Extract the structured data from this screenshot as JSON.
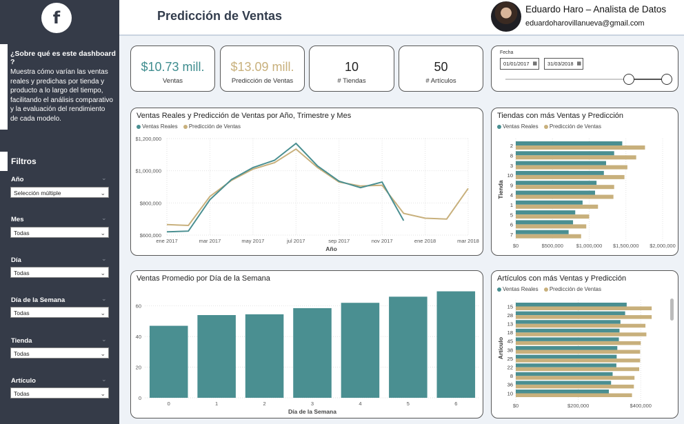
{
  "sidebar": {
    "logo": "f",
    "about_title": "¿Sobre qué es este  dashboard ?",
    "about_text": "Muestra cómo varían las ventas reales y predichas por tienda y producto a lo largo del tiempo, facilitando el análisis comparativo y la evaluación del rendimiento de cada modelo.",
    "filters_title": "Filtros",
    "filters": [
      {
        "label": "Año",
        "value": "Selección múltiple"
      },
      {
        "label": "Mes",
        "value": "Todas"
      },
      {
        "label": "Día",
        "value": "Todas"
      },
      {
        "label": "Día de la Semana",
        "value": "Todas"
      },
      {
        "label": "Tienda",
        "value": "Todas"
      },
      {
        "label": "Artículo",
        "value": "Todas"
      }
    ]
  },
  "header": {
    "title": "Predicción de Ventas",
    "author_name": "Eduardo Haro – Analista de Datos",
    "author_email": "eduardoharovillanueva@gmail.com"
  },
  "kpis": [
    {
      "value": "$10.73 mill.",
      "label": "Ventas",
      "color": "#3f8d8f"
    },
    {
      "value": "$13.09 mill.",
      "label": "Predicción de Ventas",
      "color": "#c8b07c"
    },
    {
      "value": "10",
      "label": "# Tiendas",
      "color": "#222222"
    },
    {
      "value": "50",
      "label": "# Artículos",
      "color": "#222222"
    }
  ],
  "date_filter": {
    "label": "Fecha",
    "start": "01/01/2017",
    "end": "31/03/2018"
  },
  "colors": {
    "real": "#4a8f91",
    "pred": "#c8b07c"
  },
  "chart_data": [
    {
      "type": "line",
      "title": "Ventas Reales y Predicción de Ventas por Año, Trimestre y Mes",
      "xlabel": "Año",
      "ylabel": "",
      "x": [
        "ene 2017",
        "feb 2017",
        "mar 2017",
        "abr 2017",
        "may 2017",
        "jun 2017",
        "jul 2017",
        "ago 2017",
        "sep 2017",
        "oct 2017",
        "nov 2017",
        "dic 2017",
        "ene 2018",
        "feb 2018",
        "mar 2018"
      ],
      "x_ticks": [
        "ene 2017",
        "mar 2017",
        "may 2017",
        "jul 2017",
        "sep 2017",
        "nov 2017",
        "ene 2018",
        "mar 2018"
      ],
      "y_ticks": [
        "$600,000",
        "$800,000",
        "$1,000,000",
        "$1,200,000"
      ],
      "ylim": [
        600000,
        1200000
      ],
      "series": [
        {
          "name": "Ventas Reales",
          "values": [
            620000,
            625000,
            820000,
            945000,
            1020000,
            1065000,
            1170000,
            1030000,
            935000,
            895000,
            930000,
            690000,
            null,
            null,
            null
          ]
        },
        {
          "name": "Predicción de Ventas",
          "values": [
            665000,
            660000,
            840000,
            940000,
            1010000,
            1050000,
            1135000,
            1020000,
            930000,
            905000,
            910000,
            735000,
            705000,
            700000,
            890000
          ]
        }
      ],
      "grid": true,
      "legend": "top-left"
    },
    {
      "type": "bar",
      "orientation": "horizontal",
      "title": "Tiendas con más Ventas y Predicción",
      "ylabel": "Tienda",
      "xlabel": "",
      "categories": [
        "2",
        "8",
        "3",
        "10",
        "9",
        "4",
        "1",
        "5",
        "6",
        "7"
      ],
      "x_ticks": [
        "$0",
        "$500,000",
        "$1,000,000",
        "$1,500,000",
        "$2,000,000"
      ],
      "xlim": [
        0,
        2000000
      ],
      "series": [
        {
          "name": "Ventas Reales",
          "values": [
            1450000,
            1340000,
            1230000,
            1200000,
            1100000,
            1080000,
            910000,
            810000,
            780000,
            720000
          ]
        },
        {
          "name": "Predicción de Ventas",
          "values": [
            1760000,
            1640000,
            1520000,
            1480000,
            1340000,
            1330000,
            1120000,
            1000000,
            960000,
            890000
          ]
        }
      ],
      "grid": true,
      "legend": "top-left"
    },
    {
      "type": "bar",
      "title": "Ventas Promedio por Día de la Semana",
      "xlabel": "Día de la Semana",
      "ylabel": "",
      "categories": [
        "0",
        "1",
        "2",
        "3",
        "4",
        "5",
        "6"
      ],
      "values": [
        47,
        54,
        54.5,
        58.5,
        62,
        66,
        69.5
      ],
      "y_ticks": [
        "0",
        "20",
        "40",
        "60"
      ],
      "ylim": [
        0,
        72
      ],
      "grid": true
    },
    {
      "type": "bar",
      "orientation": "horizontal",
      "title": "Artículos con más Ventas y Predicción",
      "ylabel": "Artículo",
      "xlabel": "",
      "categories": [
        "15",
        "28",
        "13",
        "18",
        "45",
        "38",
        "25",
        "22",
        "8",
        "36",
        "10"
      ],
      "x_ticks": [
        "$0",
        "$200,000",
        "$400,000"
      ],
      "xlim": [
        0,
        470000
      ],
      "series": [
        {
          "name": "Ventas Reales",
          "values": [
            355000,
            350000,
            335000,
            332000,
            330000,
            325000,
            323000,
            322000,
            310000,
            305000,
            298000
          ]
        },
        {
          "name": "Predicción de Ventas",
          "values": [
            435000,
            435000,
            415000,
            418000,
            400000,
            398000,
            398000,
            395000,
            380000,
            378000,
            372000
          ]
        }
      ],
      "grid": true,
      "legend": "top-left"
    }
  ]
}
